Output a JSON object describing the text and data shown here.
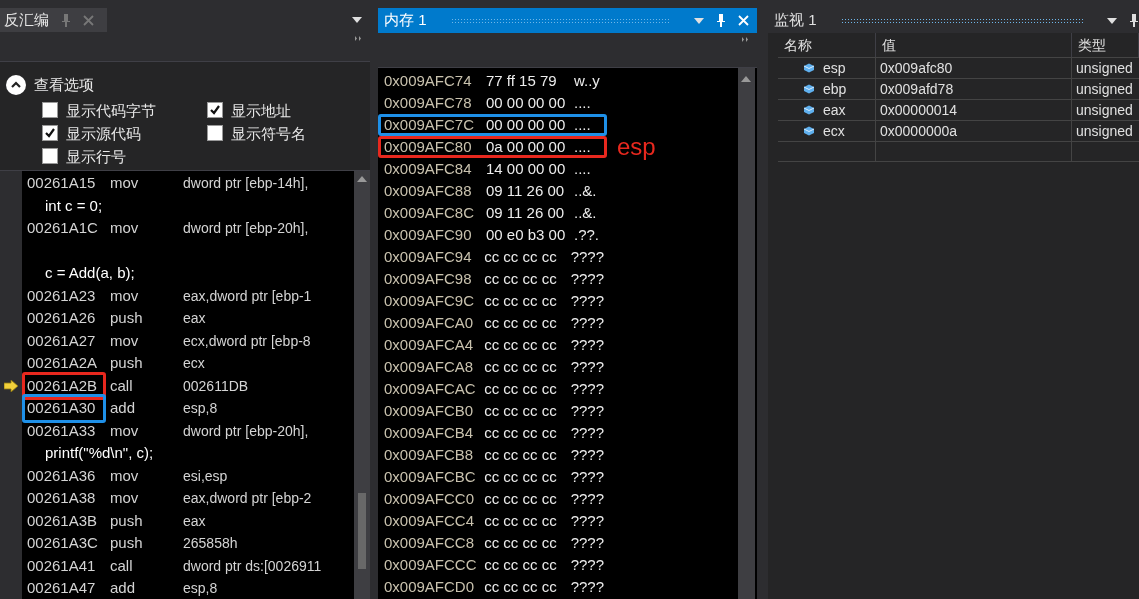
{
  "disassembly_panel": {
    "title": "反汇编",
    "options": {
      "title": "查看选项",
      "expanded": true,
      "checkboxes": [
        {
          "label": "显示代码字节",
          "checked": false
        },
        {
          "label": "显示地址",
          "checked": true
        },
        {
          "label": "显示源代码",
          "checked": true
        },
        {
          "label": "显示符号名",
          "checked": false
        },
        {
          "label": "显示行号",
          "checked": false
        }
      ]
    },
    "lines": [
      {
        "kind": "asm",
        "address": "00261A15",
        "op": "mov",
        "operand": "dword ptr [ebp-14h],",
        "current": false
      },
      {
        "kind": "source",
        "text": "int c = 0;"
      },
      {
        "kind": "asm",
        "address": "00261A1C",
        "op": "mov",
        "operand": "dword ptr [ebp-20h],",
        "current": false
      },
      {
        "kind": "blank"
      },
      {
        "kind": "source",
        "text": "c = Add(a, b);"
      },
      {
        "kind": "asm",
        "address": "00261A23",
        "op": "mov",
        "operand": "eax,dword ptr [ebp-1",
        "current": false
      },
      {
        "kind": "asm",
        "address": "00261A26",
        "op": "push",
        "operand": "eax",
        "current": false
      },
      {
        "kind": "asm",
        "address": "00261A27",
        "op": "mov",
        "operand": "ecx,dword ptr [ebp-8",
        "current": false
      },
      {
        "kind": "asm",
        "address": "00261A2A",
        "op": "push",
        "operand": "ecx",
        "current": false
      },
      {
        "kind": "asm",
        "address": "00261A2B",
        "op": "call",
        "operand": "002611DB",
        "current": true,
        "color": "#e8281e"
      },
      {
        "kind": "asm",
        "address": "00261A30",
        "op": "add",
        "operand": "esp,8",
        "current": false,
        "color": "#1e90e8"
      },
      {
        "kind": "asm",
        "address": "00261A33",
        "op": "mov",
        "operand": "dword ptr [ebp-20h],",
        "current": false
      },
      {
        "kind": "source",
        "text": "printf(\"%d\\n\", c);"
      },
      {
        "kind": "asm",
        "address": "00261A36",
        "op": "mov",
        "operand": "esi,esp",
        "current": false
      },
      {
        "kind": "asm",
        "address": "00261A38",
        "op": "mov",
        "operand": "eax,dword ptr [ebp-2",
        "current": false
      },
      {
        "kind": "asm",
        "address": "00261A3B",
        "op": "push",
        "operand": "eax",
        "current": false
      },
      {
        "kind": "asm",
        "address": "00261A3C",
        "op": "push",
        "operand": "265858h",
        "current": false
      },
      {
        "kind": "asm",
        "address": "00261A41",
        "op": "call",
        "operand": "dword ptr ds:[0026911",
        "current": false
      },
      {
        "kind": "asm",
        "address": "00261A47",
        "op": "add",
        "operand": "esp,8",
        "current": false
      }
    ]
  },
  "memory_panel": {
    "title": "内存 1",
    "active": true,
    "rows": [
      {
        "address": "0x009AFC74",
        "bytes": "77 ff 15 79",
        "chars": "w..y"
      },
      {
        "address": "0x009AFC78",
        "bytes": "00 00 00 00",
        "chars": "...."
      },
      {
        "address": "0x009AFC7C",
        "bytes": "00 00 00 00",
        "chars": "....",
        "color": "#1e90e8"
      },
      {
        "address": "0x009AFC80",
        "bytes": "0a 00 00 00",
        "chars": "....",
        "color": "#e8281e",
        "note": "esp"
      },
      {
        "address": "0x009AFC84",
        "bytes": "14 00 00 00",
        "chars": "...."
      },
      {
        "address": "0x009AFC88",
        "bytes": "09 11 26 00",
        "chars": "..&."
      },
      {
        "address": "0x009AFC8C",
        "bytes": "09 11 26 00",
        "chars": "..&."
      },
      {
        "address": "0x009AFC90",
        "bytes": "00 e0 b3 00",
        "chars": ".??."
      },
      {
        "address": "0x009AFC94",
        "bytes": "cc cc cc cc",
        "chars": "????"
      },
      {
        "address": "0x009AFC98",
        "bytes": "cc cc cc cc",
        "chars": "????"
      },
      {
        "address": "0x009AFC9C",
        "bytes": "cc cc cc cc",
        "chars": "????"
      },
      {
        "address": "0x009AFCA0",
        "bytes": "cc cc cc cc",
        "chars": "????"
      },
      {
        "address": "0x009AFCA4",
        "bytes": "cc cc cc cc",
        "chars": "????"
      },
      {
        "address": "0x009AFCA8",
        "bytes": "cc cc cc cc",
        "chars": "????"
      },
      {
        "address": "0x009AFCAC",
        "bytes": "cc cc cc cc",
        "chars": "????"
      },
      {
        "address": "0x009AFCB0",
        "bytes": "cc cc cc cc",
        "chars": "????"
      },
      {
        "address": "0x009AFCB4",
        "bytes": "cc cc cc cc",
        "chars": "????"
      },
      {
        "address": "0x009AFCB8",
        "bytes": "cc cc cc cc",
        "chars": "????"
      },
      {
        "address": "0x009AFCBC",
        "bytes": "cc cc cc cc",
        "chars": "????"
      },
      {
        "address": "0x009AFCC0",
        "bytes": "cc cc cc cc",
        "chars": "????"
      },
      {
        "address": "0x009AFCC4",
        "bytes": "cc cc cc cc",
        "chars": "????"
      },
      {
        "address": "0x009AFCC8",
        "bytes": "cc cc cc cc",
        "chars": "????"
      },
      {
        "address": "0x009AFCCC",
        "bytes": "cc cc cc cc",
        "chars": "????"
      },
      {
        "address": "0x009AFCD0",
        "bytes": "cc cc cc cc",
        "chars": "????"
      }
    ]
  },
  "watch_panel": {
    "title": "监视 1",
    "active": false,
    "columns": [
      "名称",
      "值",
      "类型"
    ],
    "rows": [
      {
        "name": "esp",
        "value": "0x009afc80",
        "type": "unsigned"
      },
      {
        "name": "ebp",
        "value": "0x009afd78",
        "type": "unsigned"
      },
      {
        "name": "eax",
        "value": "0x00000014",
        "type": "unsigned"
      },
      {
        "name": "ecx",
        "value": "0x0000000a",
        "type": "unsigned"
      }
    ]
  }
}
